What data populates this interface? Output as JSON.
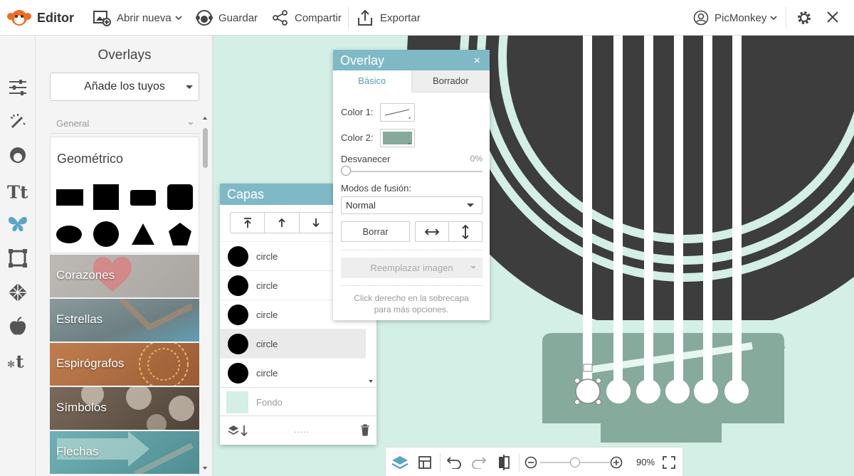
{
  "topbar": {
    "app_title": "Editor",
    "open_label": "Abrir nueva",
    "save_label": "Guardar",
    "share_label": "Compartir",
    "export_label": "Exportar",
    "account_label": "PicMonkey"
  },
  "panel": {
    "title": "Overlays",
    "add_yours_label": "Añade los tuyos",
    "category_select": "General",
    "geometric_title": "Geométrico",
    "categories": [
      {
        "label": "Corazones",
        "color": "#b5b0ab"
      },
      {
        "label": "Estrellas",
        "color": "#7d8f93"
      },
      {
        "label": "Espirógrafos",
        "color": "#b57a4c"
      },
      {
        "label": "Símbolos",
        "color": "#6b5c4e"
      },
      {
        "label": "Flechas",
        "color": "#6aa3a7"
      }
    ]
  },
  "capas": {
    "title": "Capas",
    "layers": [
      "circle",
      "circle",
      "circle",
      "circle",
      "circle"
    ],
    "background_label": "Fondo",
    "dots_label": "....."
  },
  "overlay": {
    "title": "Overlay",
    "close": "×",
    "tab_basic": "Básico",
    "tab_eraser": "Borrador",
    "color1_label": "Color 1:",
    "color2_label": "Color 2:",
    "fade_label": "Desvanecer",
    "fade_value": "0%",
    "fade_fraction": 0,
    "blend_label": "Modos de fusión:",
    "blend_value": "Normal",
    "erase_label": "Borrar",
    "replace_label": "Reemplazar imagen",
    "hint_line1": "Click derecho en la sobrecapa",
    "hint_line2": "para más opciones."
  },
  "bottombar": {
    "zoom_value": "90%"
  },
  "colors": {
    "accent": "#7fb9c6",
    "canvas_bg": "#d3efe6",
    "guitar_dark": "#3d3d3d",
    "bridge": "#86aa9c",
    "color2": "#86aa9c",
    "logo": "#f26d21"
  }
}
